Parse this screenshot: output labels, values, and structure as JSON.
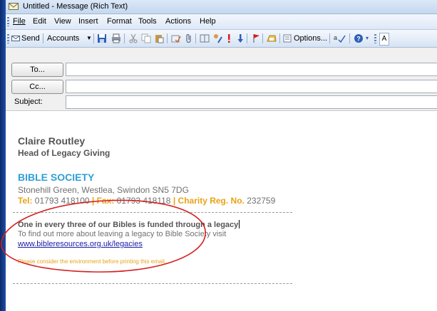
{
  "window": {
    "title": "Untitled - Message (Rich Text)"
  },
  "menu": {
    "items": [
      {
        "label": "File"
      },
      {
        "label": "Edit"
      },
      {
        "label": "View"
      },
      {
        "label": "Insert"
      },
      {
        "label": "Format"
      },
      {
        "label": "Tools"
      },
      {
        "label": "Actions"
      },
      {
        "label": "Help"
      }
    ]
  },
  "toolbar": {
    "send_label": "Send",
    "accounts_label": "Accounts",
    "options_label": "Options...",
    "overflow_label": "A"
  },
  "header": {
    "to_label": "To...",
    "cc_label": "Cc...",
    "subject_label": "Subject:",
    "to_value": "",
    "cc_value": "",
    "subject_value": ""
  },
  "signature": {
    "name": "Claire Routley",
    "role": "Head of Legacy Giving",
    "org": "BIBLE SOCIETY",
    "address": "Stonehill Green, Westlea, Swindon SN5 7DG",
    "tel_label": "Tel:",
    "tel_value": "01793 418100",
    "fax_label": "Fax:",
    "fax_value": "01793 418118",
    "charity_label": "Charity Reg. No.",
    "charity_value": "232759",
    "divider": "|",
    "legacy_headline": "One in every three of our Bibles is funded through a legacy",
    "legacy_text": "To find out more about leaving a legacy to Bible Society visit",
    "legacy_link": "www.bibleresources.org.uk/legacies",
    "environment_note": "Please consider the environment before printing this email."
  },
  "colors": {
    "accent_blue": "#2e9fd6",
    "accent_orange": "#e8a317",
    "annotation_red": "#d42020"
  }
}
